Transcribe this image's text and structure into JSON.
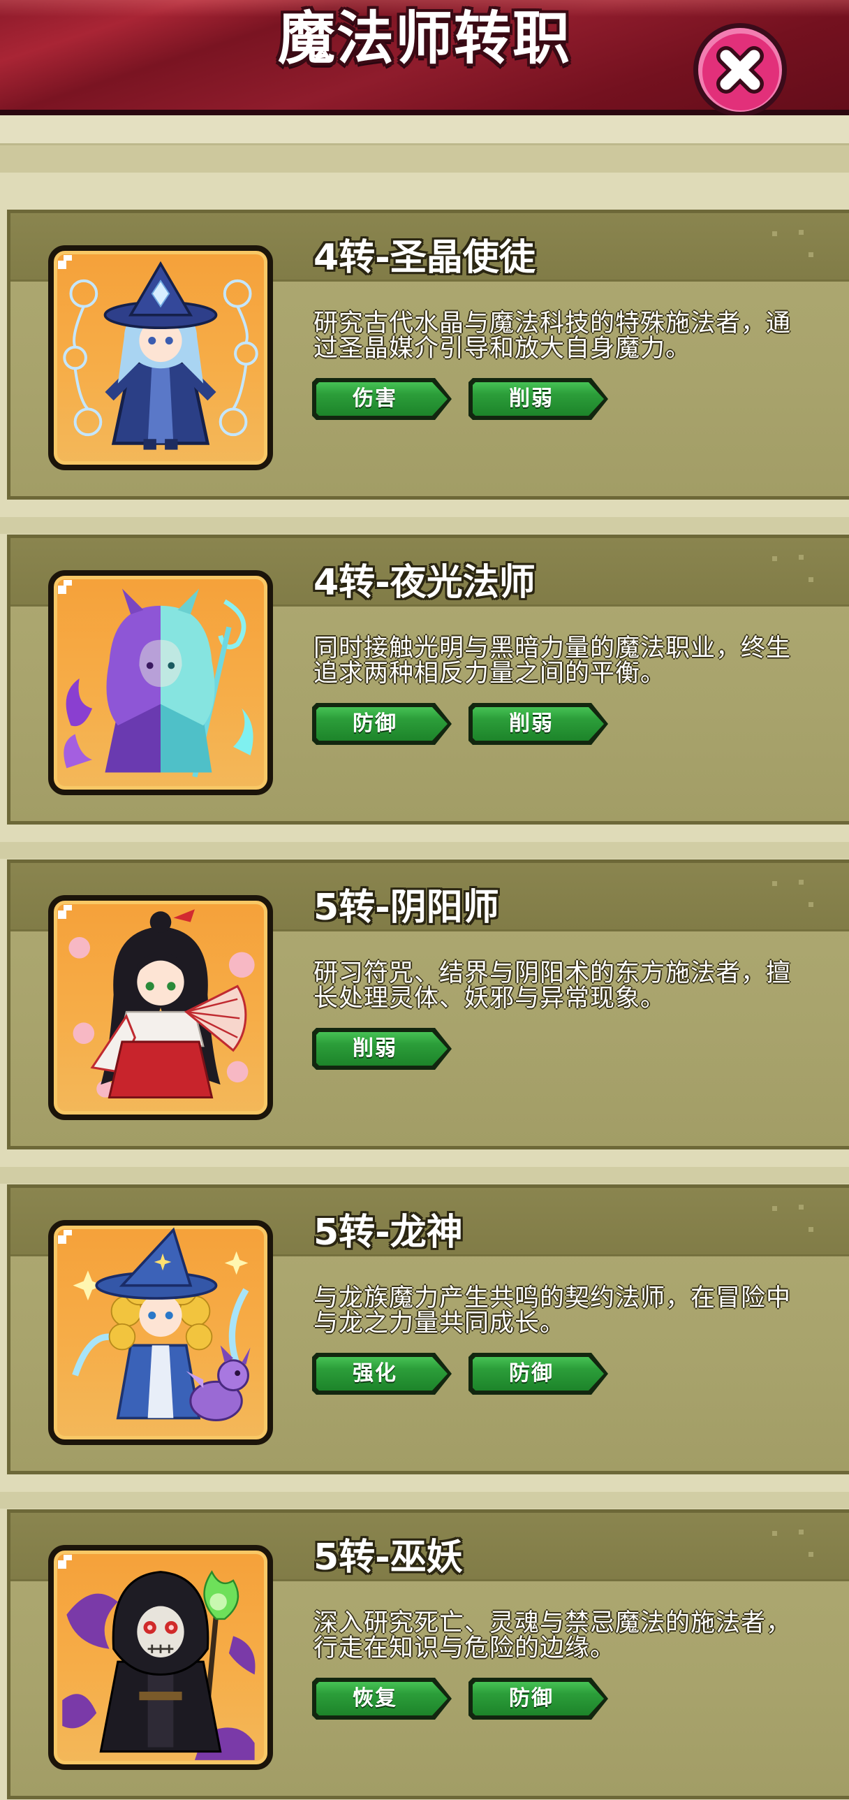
{
  "header": {
    "title": "魔法师转职",
    "close_icon": "close-x-icon"
  },
  "colors": {
    "header_bg": "#8a1a28",
    "close_button": "#e2307a",
    "page_bg": "#dfdbb8",
    "card_band": "#847f4a",
    "card_bg": "#aaa56f",
    "portrait_bg": "#f5a13a",
    "tag_green": "#2c9e3a"
  },
  "classes": [
    {
      "title": "4转-圣晶使徒",
      "desc_lines": [
        "研究古代水晶与魔法科技的特殊施法者，通",
        "过圣晶媒介引导和放大自身魔力。"
      ],
      "tags": [
        "伤害",
        "削弱"
      ],
      "portrait_icon": "crystal-saint-portrait"
    },
    {
      "title": "4转-夜光法师",
      "desc_lines": [
        "同时接触光明与黑暗力量的魔法职业，终生",
        "追求两种相反力量之间的平衡。"
      ],
      "tags": [
        "防御",
        "削弱"
      ],
      "portrait_icon": "nightlight-mage-portrait"
    },
    {
      "title": "5转-阴阳师",
      "desc_lines": [
        "研习符咒、结界与阴阳术的东方施法者，擅",
        "长处理灵体、妖邪与异常现象。"
      ],
      "tags": [
        "削弱"
      ],
      "portrait_icon": "onmyoji-portrait"
    },
    {
      "title": "5转-龙神",
      "desc_lines": [
        "与龙族魔力产生共鸣的契约法师，在冒险中",
        "与龙之力量共同成长。"
      ],
      "tags": [
        "强化",
        "防御"
      ],
      "portrait_icon": "dragon-god-portrait"
    },
    {
      "title": "5转-巫妖",
      "desc_lines": [
        "深入研究死亡、灵魂与禁忌魔法的施法者，",
        "行走在知识与危险的边缘。"
      ],
      "tags": [
        "恢复",
        "防御"
      ],
      "portrait_icon": "lich-portrait"
    }
  ]
}
